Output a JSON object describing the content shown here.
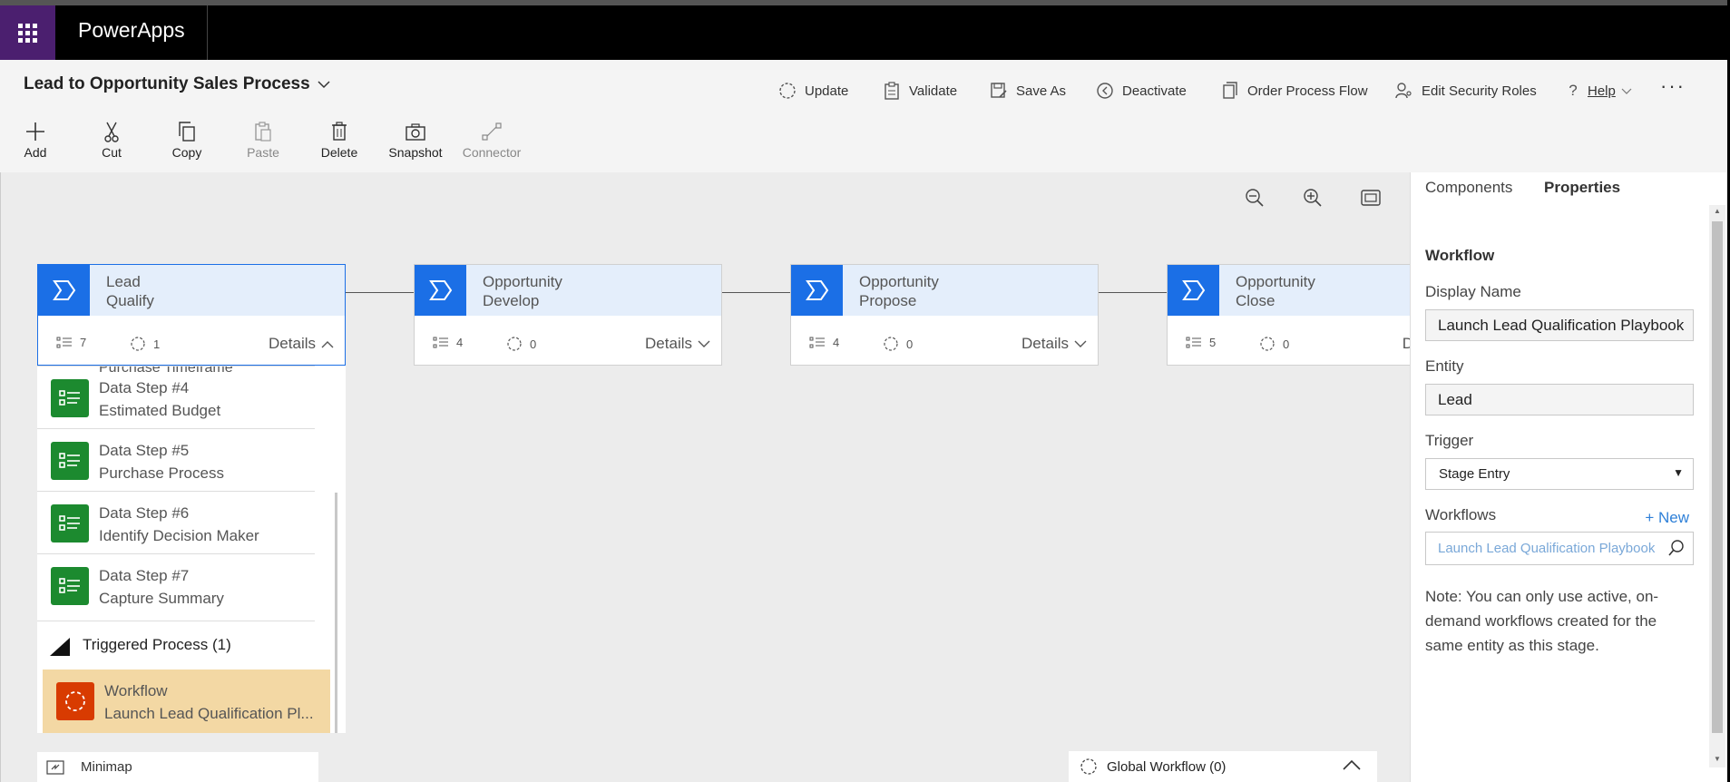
{
  "app": {
    "name": "PowerApps"
  },
  "header": {
    "process_title": "Lead to Opportunity Sales Process",
    "commands": [
      {
        "label": "Update",
        "icon": "update-icon"
      },
      {
        "label": "Validate",
        "icon": "validate-icon"
      },
      {
        "label": "Save As",
        "icon": "save-as-icon"
      },
      {
        "label": "Deactivate",
        "icon": "deactivate-icon"
      },
      {
        "label": "Order Process Flow",
        "icon": "order-flow-icon"
      },
      {
        "label": "Edit Security Roles",
        "icon": "security-roles-icon"
      },
      {
        "label": "Help",
        "icon": "help-icon"
      }
    ],
    "more_label": "···"
  },
  "toolbar": {
    "add": "Add",
    "cut": "Cut",
    "copy": "Copy",
    "paste": "Paste",
    "delete": "Delete",
    "snapshot": "Snapshot",
    "connector": "Connector"
  },
  "stages": [
    {
      "entity": "Lead",
      "name": "Qualify",
      "steps": "7",
      "workflows": "1",
      "details": "Details"
    },
    {
      "entity": "Opportunity",
      "name": "Develop",
      "steps": "4",
      "workflows": "0",
      "details": "Details"
    },
    {
      "entity": "Opportunity",
      "name": "Propose",
      "steps": "4",
      "workflows": "0",
      "details": "Details"
    },
    {
      "entity": "Opportunity",
      "name": "Close",
      "steps": "5",
      "workflows": "0",
      "details": "D"
    }
  ],
  "steplist": {
    "cut_text": "Purchase Timeframe",
    "steps": [
      {
        "title": "Data Step #4",
        "sub": "Estimated Budget"
      },
      {
        "title": "Data Step #5",
        "sub": "Purchase Process"
      },
      {
        "title": "Data Step #6",
        "sub": "Identify Decision Maker"
      },
      {
        "title": "Data Step #7",
        "sub": "Capture Summary"
      }
    ],
    "triggered": "Triggered Process (1)",
    "workflow_item": {
      "title": "Workflow",
      "sub": "Launch Lead Qualification Pl..."
    }
  },
  "minimap": {
    "label": "Minimap"
  },
  "global_workflow": {
    "label": "Global Workflow (0)"
  },
  "panel": {
    "tabs": [
      "Components",
      "Properties"
    ],
    "section": "Workflow",
    "display_name_label": "Display Name",
    "display_name_value": "Launch Lead Qualification Playbook",
    "entity_label": "Entity",
    "entity_value": "Lead",
    "trigger_label": "Trigger",
    "trigger_value": "Stage Entry",
    "workflows_label": "Workflows",
    "new_label": "+ New",
    "workflows_value": "Launch Lead Qualification Playbook",
    "note": "Note: You can only use active, on-demand workflows created for the same entity as this stage."
  },
  "colors": {
    "stage_blue": "#1b6fe6",
    "step_green": "#1c8a2f",
    "workflow_orange": "#d83b01",
    "selected_item": "#f3d8a4",
    "waffle_purple": "#4b1f6f"
  }
}
